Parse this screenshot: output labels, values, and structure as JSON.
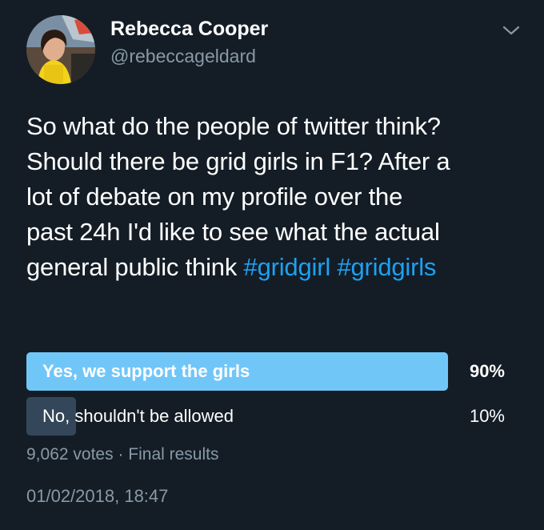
{
  "user": {
    "name": "Rebecca Cooper",
    "handle": "@rebeccageldard"
  },
  "tweet": {
    "text_lines": [
      "So what do the people of twitter think?",
      "Should there be grid girls in F1?  After a",
      "lot of debate on my profile over the",
      "past 24h I'd like to see what the actual",
      "general public think "
    ],
    "hashtags": [
      "#gridgirl",
      "#gridgirls"
    ]
  },
  "poll": {
    "options": [
      {
        "label": "Yes, we support the girls",
        "percent_text": "90%",
        "share": 0.9
      },
      {
        "label": "No, shouldn't be allowed",
        "percent_text": "10%",
        "share": 0.1
      }
    ],
    "votes": "9,062 votes",
    "status": "Final results",
    "separator": "·"
  },
  "timestamp": "01/02/2018, 18:47",
  "colors": {
    "background": "#141d26",
    "winner_bar": "#71c6f8",
    "loser_bar": "#34475a",
    "link": "#1da1f2",
    "muted": "#8899a6"
  },
  "icons": {
    "caret": "chevron-down-icon",
    "avatar": "avatar"
  }
}
